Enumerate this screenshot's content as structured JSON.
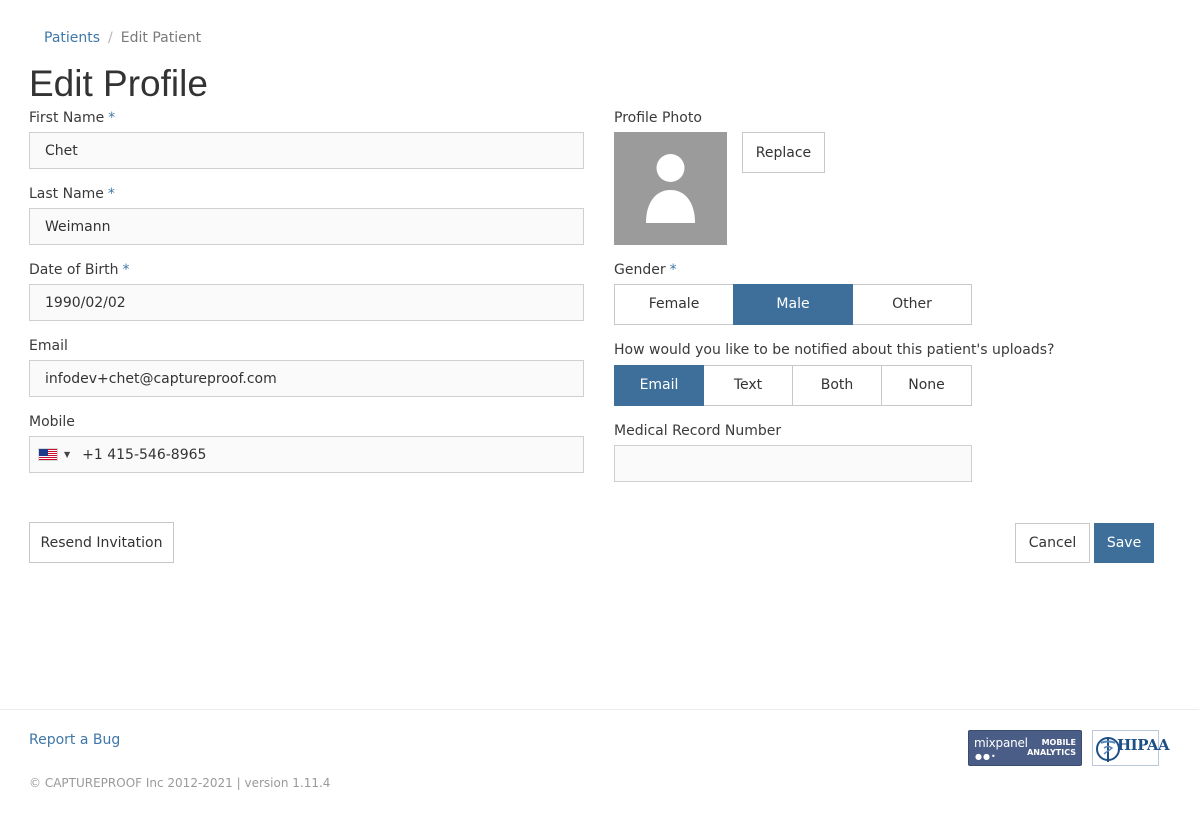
{
  "breadcrumb": {
    "parent": "Patients",
    "separator": "/",
    "current": "Edit Patient"
  },
  "page_title": "Edit Profile",
  "form": {
    "required_marker": "*",
    "first_name": {
      "label": "First Name",
      "value": "Chet"
    },
    "last_name": {
      "label": "Last Name",
      "value": "Weimann"
    },
    "dob": {
      "label": "Date of Birth",
      "value": "1990/02/02"
    },
    "email": {
      "label": "Email",
      "value": "infodev+chet@captureproof.com"
    },
    "mobile": {
      "label": "Mobile",
      "value": "+1 415-546-8965",
      "country_flag": "us-flag-icon"
    },
    "profile_photo": {
      "label": "Profile Photo",
      "replace_label": "Replace"
    },
    "gender": {
      "label": "Gender",
      "options": [
        {
          "label": "Female",
          "active": false
        },
        {
          "label": "Male",
          "active": true
        },
        {
          "label": "Other",
          "active": false
        }
      ]
    },
    "notification": {
      "label": "How would you like to be notified about this patient's uploads?",
      "options": [
        {
          "label": "Email",
          "active": true
        },
        {
          "label": "Text",
          "active": false
        },
        {
          "label": "Both",
          "active": false
        },
        {
          "label": "None",
          "active": false
        }
      ]
    },
    "mrn": {
      "label": "Medical Record Number",
      "value": ""
    }
  },
  "actions": {
    "resend_label": "Resend Invitation",
    "cancel_label": "Cancel",
    "save_label": "Save"
  },
  "footer": {
    "report_bug": "Report a Bug",
    "copyright": "© CAPTUREPROOF Inc 2012-2021 | version 1.11.4",
    "mixpanel": {
      "name": "mixpanel",
      "tag_line1": "MOBILE",
      "tag_line2": "ANALYTICS"
    },
    "hipaa": {
      "text": "HIPAA"
    }
  },
  "colors": {
    "primary": "#3d6f9a",
    "link": "#3f77a8",
    "avatar_bg": "#9b9b9b"
  }
}
